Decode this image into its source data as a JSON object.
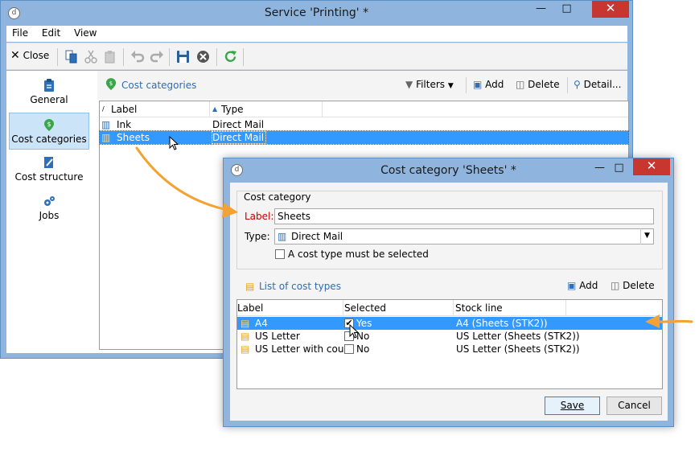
{
  "main_window": {
    "title": "Service 'Printing' *",
    "menu": [
      "File",
      "Edit",
      "View"
    ],
    "toolbar": {
      "close_label": "Close"
    },
    "sidebar": [
      {
        "label": "General",
        "icon": "clipboard-icon"
      },
      {
        "label": "Cost categories",
        "icon": "money-pin-icon",
        "active": true
      },
      {
        "label": "Cost structure",
        "icon": "document-edit-icon"
      },
      {
        "label": "Jobs",
        "icon": "gears-icon"
      }
    ],
    "panel": {
      "title": "Cost categories",
      "filters_label": "Filters",
      "add_label": "Add",
      "delete_label": "Delete",
      "detail_label": "Detail...",
      "columns": {
        "label": "Label",
        "type": "Type"
      },
      "rows": [
        {
          "label": "Ink",
          "type": "Direct Mail",
          "selected": false
        },
        {
          "label": "Sheets",
          "type": "Direct Mail",
          "selected": true
        }
      ]
    }
  },
  "dialog": {
    "title": "Cost category 'Sheets' *",
    "group_title": "Cost category",
    "label_field": {
      "label": "Label:",
      "value": "Sheets"
    },
    "type_field": {
      "label": "Type:",
      "value": "Direct Mail"
    },
    "checkbox_label": "A cost type must be selected",
    "list_title": "List of cost types",
    "add_label": "Add",
    "delete_label": "Delete",
    "columns": {
      "label": "Label",
      "selected": "Selected",
      "stock": "Stock line"
    },
    "rows": [
      {
        "label": "A4",
        "selected": "Yes",
        "checked": true,
        "stock": "A4 (Sheets (STK2))",
        "highlighted": true
      },
      {
        "label": "US Letter",
        "selected": "No",
        "checked": false,
        "stock": "US Letter (Sheets (STK2))",
        "highlighted": false
      },
      {
        "label": "US Letter with cou...",
        "selected": "No",
        "checked": false,
        "stock": "US Letter (Sheets (STK2))",
        "highlighted": false
      }
    ],
    "save_label": "Save",
    "cancel_label": "Cancel"
  },
  "colors": {
    "accent": "#2e6db5",
    "selection": "#3399ff",
    "annotation_arrow": "#f4a233",
    "close_button": "#c7372f",
    "required_label": "#c00000"
  }
}
